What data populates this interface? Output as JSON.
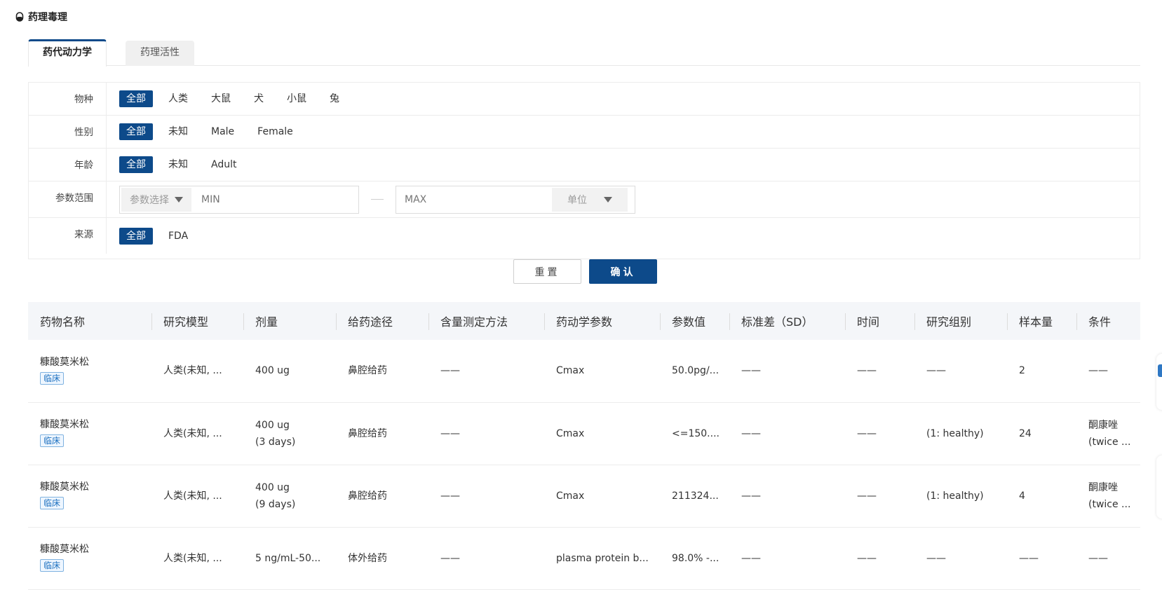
{
  "section": {
    "title": "药理毒理",
    "icon": "pill-icon"
  },
  "tabs": [
    {
      "label": "药代动力学",
      "active": true
    },
    {
      "label": "药理活性",
      "active": false
    }
  ],
  "filters": {
    "species": {
      "label": "物种",
      "options": [
        "全部",
        "人类",
        "大鼠",
        "犬",
        "小鼠",
        "兔"
      ],
      "selected": "全部"
    },
    "sex": {
      "label": "性别",
      "options": [
        "全部",
        "未知",
        "Male",
        "Female"
      ],
      "selected": "全部"
    },
    "age": {
      "label": "年龄",
      "options": [
        "全部",
        "未知",
        "Adult"
      ],
      "selected": "全部"
    },
    "param_range": {
      "label": "参数范围",
      "param_select": "参数选择",
      "min_placeholder": "MIN",
      "max_placeholder": "MAX",
      "unit_select": "单位"
    },
    "source": {
      "label": "来源",
      "options": [
        "全部",
        "FDA"
      ],
      "selected": "全部"
    }
  },
  "buttons": {
    "reset": "重置",
    "confirm": "确认"
  },
  "table": {
    "headers": [
      "药物名称",
      "研究模型",
      "剂量",
      "给药途径",
      "含量测定方法",
      "药动学参数",
      "参数值",
      "标准差（SD）",
      "时间",
      "研究组别",
      "样本量",
      "条件"
    ],
    "rows": [
      {
        "name": "糠酸莫米松",
        "tag": "临床",
        "model": "人类(未知, ...",
        "dose1": "400 ug",
        "dose2": "",
        "route": "鼻腔给药",
        "method": "——",
        "param": "Cmax",
        "value": "50.0pg/...",
        "sd": "——",
        "time": "——",
        "group": "——",
        "n": "2",
        "cond1": "——",
        "cond2": ""
      },
      {
        "name": "糠酸莫米松",
        "tag": "临床",
        "model": "人类(未知, ...",
        "dose1": "400 ug",
        "dose2": "(3 days)",
        "route": "鼻腔给药",
        "method": "——",
        "param": "Cmax",
        "value": "<=150....",
        "sd": "——",
        "time": "——",
        "group": "(1: healthy)",
        "n": "24",
        "cond1": "酮康唑",
        "cond2": "(twice ..."
      },
      {
        "name": "糠酸莫米松",
        "tag": "临床",
        "model": "人类(未知, ...",
        "dose1": "400 ug",
        "dose2": "(9 days)",
        "route": "鼻腔给药",
        "method": "——",
        "param": "Cmax",
        "value": "211324...",
        "sd": "——",
        "time": "——",
        "group": "(1: healthy)",
        "n": "4",
        "cond1": "酮康唑",
        "cond2": "(twice ..."
      },
      {
        "name": "糠酸莫米松",
        "tag": "临床",
        "model": "人类(未知, ...",
        "dose1": "5 ng/mL-50...",
        "dose2": "",
        "route": "体外给药",
        "method": "——",
        "param": "plasma protein b...",
        "value": "98.0% -...",
        "sd": "——",
        "time": "——",
        "group": "——",
        "n": "——",
        "cond1": "——",
        "cond2": ""
      }
    ]
  },
  "colors": {
    "primary": "#0d4a8a",
    "tag": "#1a6fbf"
  }
}
